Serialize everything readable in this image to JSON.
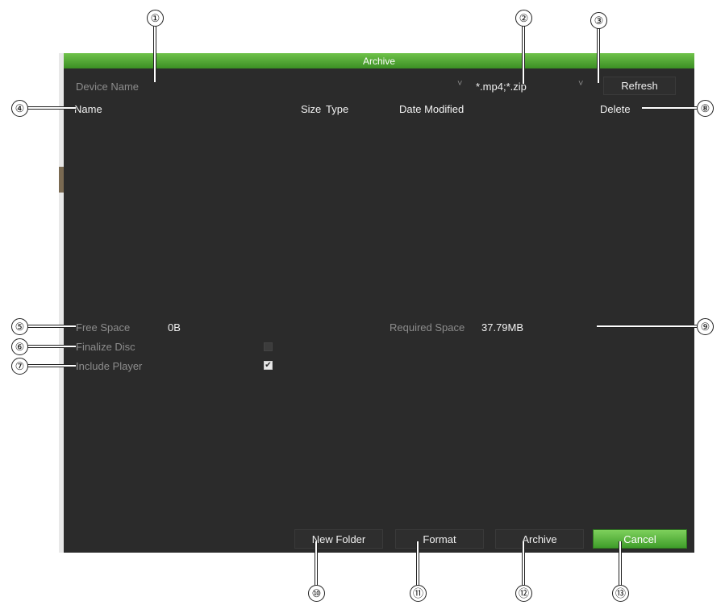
{
  "window": {
    "title": "Archive"
  },
  "toolbar": {
    "device_label": "Device Name",
    "device_dropdown_arrow": "˅",
    "file_filter": "*.mp4;*.zip",
    "filter_dropdown_arrow": "˅",
    "refresh_label": "Refresh"
  },
  "file_table": {
    "columns": [
      "Name",
      "Size",
      "Type",
      "Date Modified",
      "Delete"
    ],
    "rows": []
  },
  "storage": {
    "free_space_label": "Free Space",
    "free_space_value": "0B",
    "required_space_label": "Required Space",
    "required_space_value": "37.79MB"
  },
  "options": {
    "finalize_disc_label": "Finalize Disc",
    "finalize_disc_checked": false,
    "include_player_label": "Include Player",
    "include_player_checked": true,
    "check_mark": "✔"
  },
  "footer": {
    "new_folder_label": "New Folder",
    "format_label": "Format",
    "archive_label": "Archive",
    "cancel_label": "Cancel"
  },
  "callouts": [
    "①",
    "②",
    "③",
    "④",
    "⑤",
    "⑥",
    "⑦",
    "⑧",
    "⑨",
    "⑩",
    "⑪",
    "⑫",
    "⑬"
  ],
  "colors": {
    "titlebar_green": "#4fa834",
    "panel_bg": "#2b2b2b",
    "cancel_green": "#5cb83e"
  },
  "icons": {
    "device_dropdown": "chevron-down-icon",
    "filter_dropdown": "chevron-down-icon",
    "include_player_check": "checkmark-icon"
  }
}
